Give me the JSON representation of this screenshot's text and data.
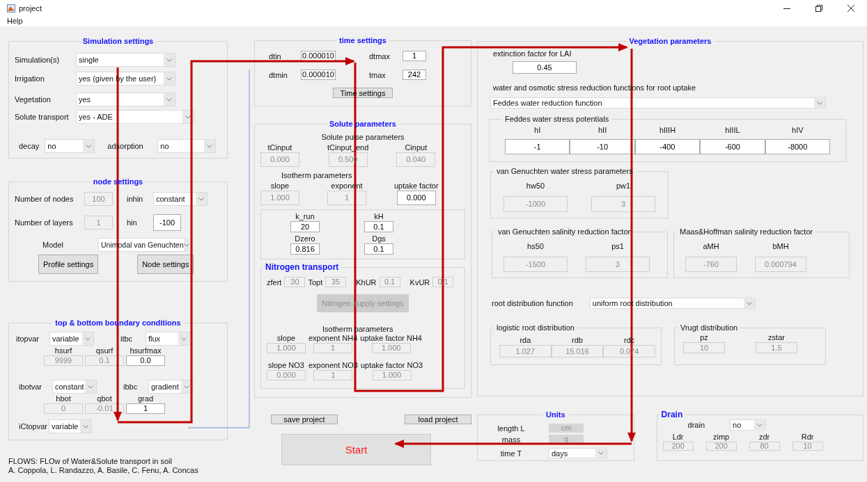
{
  "window": {
    "title": "project"
  },
  "menu": [
    {
      "label": "Help"
    }
  ],
  "left_column": [
    {
      "kind": "section",
      "title": "Simulation settings",
      "content": [
        {
          "kind": "row",
          "items": [
            {
              "kind": "label",
              "text": "Simulation(s)"
            },
            {
              "kind": "dropdown",
              "value": "single"
            }
          ]
        },
        {
          "kind": "row",
          "items": [
            {
              "kind": "label",
              "text": "Irrigation"
            },
            {
              "kind": "dropdown",
              "value": "yes (given by the user)"
            }
          ]
        },
        {
          "kind": "row",
          "items": [
            {
              "kind": "label",
              "text": "Vegetation"
            },
            {
              "kind": "dropdown",
              "value": "yes"
            }
          ]
        },
        {
          "kind": "row",
          "items": [
            {
              "kind": "label",
              "text": "Solute transport"
            },
            {
              "kind": "dropdown",
              "value": "yes - ADE"
            }
          ]
        },
        {
          "kind": "row",
          "items": [
            {
              "kind": "label",
              "text": "decay"
            },
            {
              "kind": "dropdown",
              "value": "no"
            },
            {
              "kind": "label",
              "text": "adsorption"
            },
            {
              "kind": "dropdown",
              "value": "no"
            }
          ]
        }
      ]
    },
    {
      "kind": "section",
      "title": "node settings",
      "content": [
        {
          "kind": "row",
          "items": [
            {
              "kind": "label",
              "text": "Number of nodes"
            },
            {
              "kind": "field",
              "value": "100",
              "disabled": true
            },
            {
              "kind": "label",
              "text": "inhin"
            },
            {
              "kind": "dropdown",
              "value": "constant"
            }
          ]
        },
        {
          "kind": "row",
          "items": [
            {
              "kind": "label",
              "text": "Number of layers"
            },
            {
              "kind": "field",
              "value": "1",
              "disabled": true
            },
            {
              "kind": "label",
              "text": "hin"
            },
            {
              "kind": "field",
              "value": "-100",
              "disabled": false
            }
          ]
        },
        {
          "kind": "row",
          "items": [
            {
              "kind": "label",
              "text": "Model"
            },
            {
              "kind": "dropdown",
              "value": "Unimodal van Genuchten"
            }
          ]
        },
        {
          "kind": "row",
          "items": [
            {
              "kind": "button",
              "label": "Profile settings",
              "disabled": false
            },
            {
              "kind": "button",
              "label": "Node settings",
              "disabled": false
            }
          ]
        }
      ]
    },
    {
      "kind": "section",
      "title": "top & bottom boundary conditions",
      "content": [
        {
          "kind": "row",
          "items": [
            {
              "kind": "label",
              "text": "itopvar"
            },
            {
              "kind": "dropdown",
              "value": "variable"
            },
            {
              "kind": "label",
              "text": "itbc"
            },
            {
              "kind": "dropdown",
              "value": "flux"
            }
          ]
        },
        {
          "kind": "row",
          "items": [
            {
              "kind": "param",
              "label": "hsurf",
              "value": "9999",
              "disabled": true
            },
            {
              "kind": "param",
              "label": "qsurf",
              "value": "0.1",
              "disabled": true
            },
            {
              "kind": "param",
              "label": "hsurfmax",
              "value": "0.0",
              "disabled": false
            }
          ]
        },
        {
          "kind": "row",
          "items": [
            {
              "kind": "label",
              "text": "ibotvar"
            },
            {
              "kind": "dropdown",
              "value": "constant"
            },
            {
              "kind": "label",
              "text": "ibbc"
            },
            {
              "kind": "dropdown",
              "value": "gradient"
            }
          ]
        },
        {
          "kind": "row",
          "items": [
            {
              "kind": "param",
              "label": "hbot",
              "value": "0",
              "disabled": true
            },
            {
              "kind": "param",
              "label": "qbot",
              "value": "-0.01",
              "disabled": true
            },
            {
              "kind": "param",
              "label": "grad",
              "value": "1",
              "disabled": false
            }
          ]
        },
        {
          "kind": "row",
          "items": [
            {
              "kind": "label",
              "text": "iCtopvar"
            },
            {
              "kind": "dropdown",
              "value": "variable"
            }
          ]
        }
      ]
    },
    {
      "kind": "text",
      "lines": [
        "FLOWS: FLOw of Water&Solute transport in soil",
        "A. Coppola, L. Randazzo, A. Basile, C. Fenu, A. Concas"
      ]
    }
  ],
  "middle_column": [
    {
      "kind": "section",
      "title": "time settings",
      "content": [
        {
          "kind": "row",
          "items": [
            {
              "kind": "label",
              "text": "dtin"
            },
            {
              "kind": "field",
              "value": "0.000010",
              "disabled": false
            },
            {
              "kind": "label",
              "text": "dtmax"
            },
            {
              "kind": "field",
              "value": "1",
              "disabled": false
            }
          ]
        },
        {
          "kind": "row",
          "items": [
            {
              "kind": "label",
              "text": "dtmin"
            },
            {
              "kind": "field",
              "value": "0.000010",
              "disabled": false
            },
            {
              "kind": "label",
              "text": "tmax"
            },
            {
              "kind": "field",
              "value": "242",
              "disabled": false
            }
          ]
        },
        {
          "kind": "row",
          "items": [
            {
              "kind": "button",
              "label": "Time settings",
              "disabled": false
            }
          ]
        }
      ]
    },
    {
      "kind": "section",
      "title": "Solute parameters",
      "content": [
        {
          "kind": "heading",
          "text": "Solute pulse parameters"
        },
        {
          "kind": "row",
          "items": [
            {
              "kind": "param",
              "label": "tCinput",
              "value": "0.000",
              "disabled": true
            },
            {
              "kind": "param",
              "label": "tCinput_end",
              "value": "0.500",
              "disabled": true
            },
            {
              "kind": "param",
              "label": "Cinput",
              "value": "0.040",
              "disabled": true
            }
          ]
        },
        {
          "kind": "heading",
          "text": "Isotherm parameters"
        },
        {
          "kind": "row",
          "items": [
            {
              "kind": "param",
              "label": "slope",
              "value": "1.000",
              "disabled": true
            },
            {
              "kind": "param",
              "label": "exponent",
              "value": "1",
              "disabled": true
            },
            {
              "kind": "param",
              "label": "uptake factor",
              "value": "0.000",
              "disabled": false
            }
          ]
        },
        {
          "kind": "box",
          "content": [
            {
              "kind": "row",
              "items": [
                {
                  "kind": "param",
                  "label": "k_run",
                  "value": "20",
                  "disabled": false
                },
                {
                  "kind": "param",
                  "label": "kH",
                  "value": "0.1",
                  "disabled": false
                }
              ]
            },
            {
              "kind": "row",
              "items": [
                {
                  "kind": "param",
                  "label": "Dzero",
                  "value": "0.816",
                  "disabled": false
                },
                {
                  "kind": "param",
                  "label": "Dgs",
                  "value": "0.1",
                  "disabled": false
                }
              ]
            }
          ]
        },
        {
          "kind": "labeled",
          "title": "Nitrogen transport",
          "content": [
            {
              "kind": "row",
              "items": [
                {
                  "kind": "label",
                  "text": "zfert"
                },
                {
                  "kind": "field",
                  "value": "30",
                  "disabled": true
                },
                {
                  "kind": "label",
                  "text": "Topt"
                },
                {
                  "kind": "field",
                  "value": "35",
                  "disabled": true
                },
                {
                  "kind": "label",
                  "text": "KhUR"
                },
                {
                  "kind": "field",
                  "value": "0.1",
                  "disabled": true
                },
                {
                  "kind": "label",
                  "text": "KvUR"
                },
                {
                  "kind": "field",
                  "value": "0.1",
                  "disabled": true
                }
              ]
            },
            {
              "kind": "row",
              "items": [
                {
                  "kind": "button",
                  "label": "Nitrogen supply settings",
                  "disabled": true
                }
              ]
            },
            {
              "kind": "heading",
              "text": "Isotherm parameters"
            },
            {
              "kind": "row",
              "items": [
                {
                  "kind": "param",
                  "label": "slope",
                  "value": "1.000",
                  "disabled": true
                },
                {
                  "kind": "param",
                  "label": "exponent NH4",
                  "value": "1",
                  "disabled": true
                },
                {
                  "kind": "param",
                  "label": "uptake factor NH4",
                  "value": "1.000",
                  "disabled": true
                }
              ]
            },
            {
              "kind": "row",
              "items": [
                {
                  "kind": "param",
                  "label": "slope NO3",
                  "value": "0.000",
                  "disabled": true
                },
                {
                  "kind": "param",
                  "label": "exponent NO3",
                  "value": "1",
                  "disabled": true
                },
                {
                  "kind": "param",
                  "label": "uptake factor NO3",
                  "value": "1.000",
                  "disabled": true
                }
              ]
            }
          ]
        }
      ]
    },
    {
      "kind": "row",
      "items": [
        {
          "kind": "button",
          "label": "save project",
          "disabled": false
        },
        {
          "kind": "button",
          "label": "load project",
          "disabled": false
        }
      ]
    },
    {
      "kind": "row",
      "items": [
        {
          "kind": "primary",
          "label": "Start"
        }
      ]
    }
  ],
  "right_column": [
    {
      "kind": "section",
      "title": "Vegetation parameters",
      "content": [
        {
          "kind": "row",
          "items": [
            {
              "kind": "param",
              "label": "extinction factor for LAI",
              "value": "0.45",
              "disabled": false
            }
          ]
        },
        {
          "kind": "heading",
          "text": "water and osmotic stress reduction functions for root uptake"
        },
        {
          "kind": "row",
          "items": [
            {
              "kind": "dropdown",
              "value": "Feddes water reduction function"
            }
          ]
        },
        {
          "kind": "sub",
          "title": "Feddes water stress potentials",
          "content": [
            {
              "kind": "table",
              "columns": [
                {
                  "label": "hI",
                  "value": "-1",
                  "disabled": false
                },
                {
                  "label": "hII",
                  "value": "-10",
                  "disabled": false
                },
                {
                  "label": "hIIIH",
                  "value": "-400",
                  "disabled": false
                },
                {
                  "label": "hIIIL",
                  "value": "-600",
                  "disabled": false
                },
                {
                  "label": "hIV",
                  "value": "-8000",
                  "disabled": false
                }
              ]
            }
          ]
        },
        {
          "kind": "sub",
          "title": "van Genuchten water stress parameters",
          "content": [
            {
              "kind": "row",
              "items": [
                {
                  "kind": "param",
                  "label": "hw50",
                  "value": "-1000",
                  "disabled": true
                },
                {
                  "kind": "param",
                  "label": "pw1",
                  "value": "3",
                  "disabled": true
                }
              ]
            }
          ]
        },
        {
          "kind": "panels",
          "panels": [
            {
              "kind": "sub",
              "title": "van Genuchten salinity reduction factor",
              "content": [
                {
                  "kind": "row",
                  "items": [
                    {
                      "kind": "param",
                      "label": "hs50",
                      "value": "-1500",
                      "disabled": true
                    },
                    {
                      "kind": "param",
                      "label": "ps1",
                      "value": "3",
                      "disabled": true
                    }
                  ]
                }
              ]
            },
            {
              "kind": "sub",
              "title": "Maas&Hoffman salinity reduction factor",
              "content": [
                {
                  "kind": "row",
                  "items": [
                    {
                      "kind": "param",
                      "label": "aMH",
                      "value": "-760",
                      "disabled": true
                    },
                    {
                      "kind": "param",
                      "label": "bMH",
                      "value": "0.000794",
                      "disabled": true
                    }
                  ]
                }
              ]
            }
          ]
        },
        {
          "kind": "row",
          "items": [
            {
              "kind": "label",
              "text": "root distribution function"
            },
            {
              "kind": "dropdown",
              "value": "uniform root distribution"
            }
          ]
        },
        {
          "kind": "panels",
          "panels": [
            {
              "kind": "sub",
              "title": "logistic root distribution",
              "content": [
                {
                  "kind": "table",
                  "columns": [
                    {
                      "label": "rda",
                      "value": "1.027",
                      "disabled": true
                    },
                    {
                      "label": "rdb",
                      "value": "15.016",
                      "disabled": true
                    },
                    {
                      "label": "rdc",
                      "value": "0.074",
                      "disabled": true
                    }
                  ]
                }
              ]
            },
            {
              "kind": "sub",
              "title": "Vrugt distribution",
              "content": [
                {
                  "kind": "row",
                  "items": [
                    {
                      "kind": "param",
                      "label": "pz",
                      "value": "10",
                      "disabled": true
                    },
                    {
                      "kind": "param",
                      "label": "zstar",
                      "value": "1.5",
                      "disabled": true
                    }
                  ]
                }
              ]
            }
          ]
        }
      ]
    },
    {
      "kind": "panels",
      "panels": [
        {
          "kind": "section",
          "title": "Units",
          "content": [
            {
              "kind": "row",
              "items": [
                {
                  "kind": "label",
                  "text": "length L"
                },
                {
                  "kind": "field",
                  "value": "cm",
                  "disabled": true
                }
              ]
            },
            {
              "kind": "row",
              "items": [
                {
                  "kind": "label",
                  "text": "mass"
                },
                {
                  "kind": "field",
                  "value": "g",
                  "disabled": true
                }
              ]
            },
            {
              "kind": "row",
              "items": [
                {
                  "kind": "label",
                  "text": "time T"
                },
                {
                  "kind": "dropdown",
                  "value": "days"
                }
              ]
            }
          ]
        },
        {
          "kind": "labeled",
          "title": "Drain",
          "content": [
            {
              "kind": "row",
              "items": [
                {
                  "kind": "label",
                  "text": "drain"
                },
                {
                  "kind": "dropdown",
                  "value": "no"
                }
              ]
            },
            {
              "kind": "row",
              "items": [
                {
                  "kind": "param",
                  "label": "Ldr",
                  "value": "200",
                  "disabled": true
                },
                {
                  "kind": "param",
                  "label": "zimp",
                  "value": "200",
                  "disabled": true
                },
                {
                  "kind": "param",
                  "label": "zdr",
                  "value": "80",
                  "disabled": true
                },
                {
                  "kind": "param",
                  "label": "Rdr",
                  "value": "10",
                  "disabled": true
                }
              ]
            }
          ]
        }
      ]
    }
  ]
}
